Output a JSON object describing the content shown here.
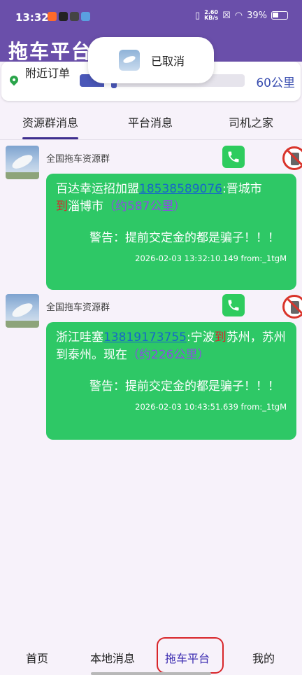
{
  "status_bar": {
    "time": "13:32",
    "net_speed_value": "2.60",
    "net_speed_unit": "KB/s",
    "battery": "39%"
  },
  "app": {
    "title": "拖车平台"
  },
  "toast": {
    "text": "已取消"
  },
  "filter": {
    "nearby_label": "附近订单",
    "distance": "60公里",
    "slider_level": 0.25
  },
  "tabs": [
    {
      "label": "资源群消息",
      "active": true
    },
    {
      "label": "平台消息",
      "active": false
    },
    {
      "label": "司机之家",
      "active": false
    }
  ],
  "messages": [
    {
      "sender": "全国拖车资源群",
      "prefix": "百达幸运招加盟",
      "phone": "18538589076",
      "route_a": ":晋城市",
      "dao": "到",
      "route_b": "淄博市",
      "distance": "（约587公里）",
      "warning": "警告：提前交定金的都是骗子！！！",
      "meta": "2026-02-03 13:32:10.149 from:_1tgM"
    },
    {
      "sender": "全国拖车资源群",
      "prefix": "浙江哇塞",
      "phone": "13819173755",
      "route_a": ":宁波",
      "dao": "到",
      "route_b": "苏州，苏州到泰州。现在",
      "distance": "（约226公里）",
      "warning": "警告：提前交定金的都是骗子！！！",
      "meta": "2026-02-03 10:43:51.639 from:_1tgM"
    }
  ],
  "bottom_nav": [
    {
      "label": "首页",
      "active": false
    },
    {
      "label": "本地消息",
      "active": false
    },
    {
      "label": "拖车平台",
      "active": true
    },
    {
      "label": "我的",
      "active": false
    }
  ],
  "colors": {
    "header": "#6a4faa",
    "bubble": "#2ec866",
    "phone_link": "#1668c8",
    "dao": "#d8262a",
    "distance": "#8a4fe0",
    "highlight": "#d8262a"
  }
}
